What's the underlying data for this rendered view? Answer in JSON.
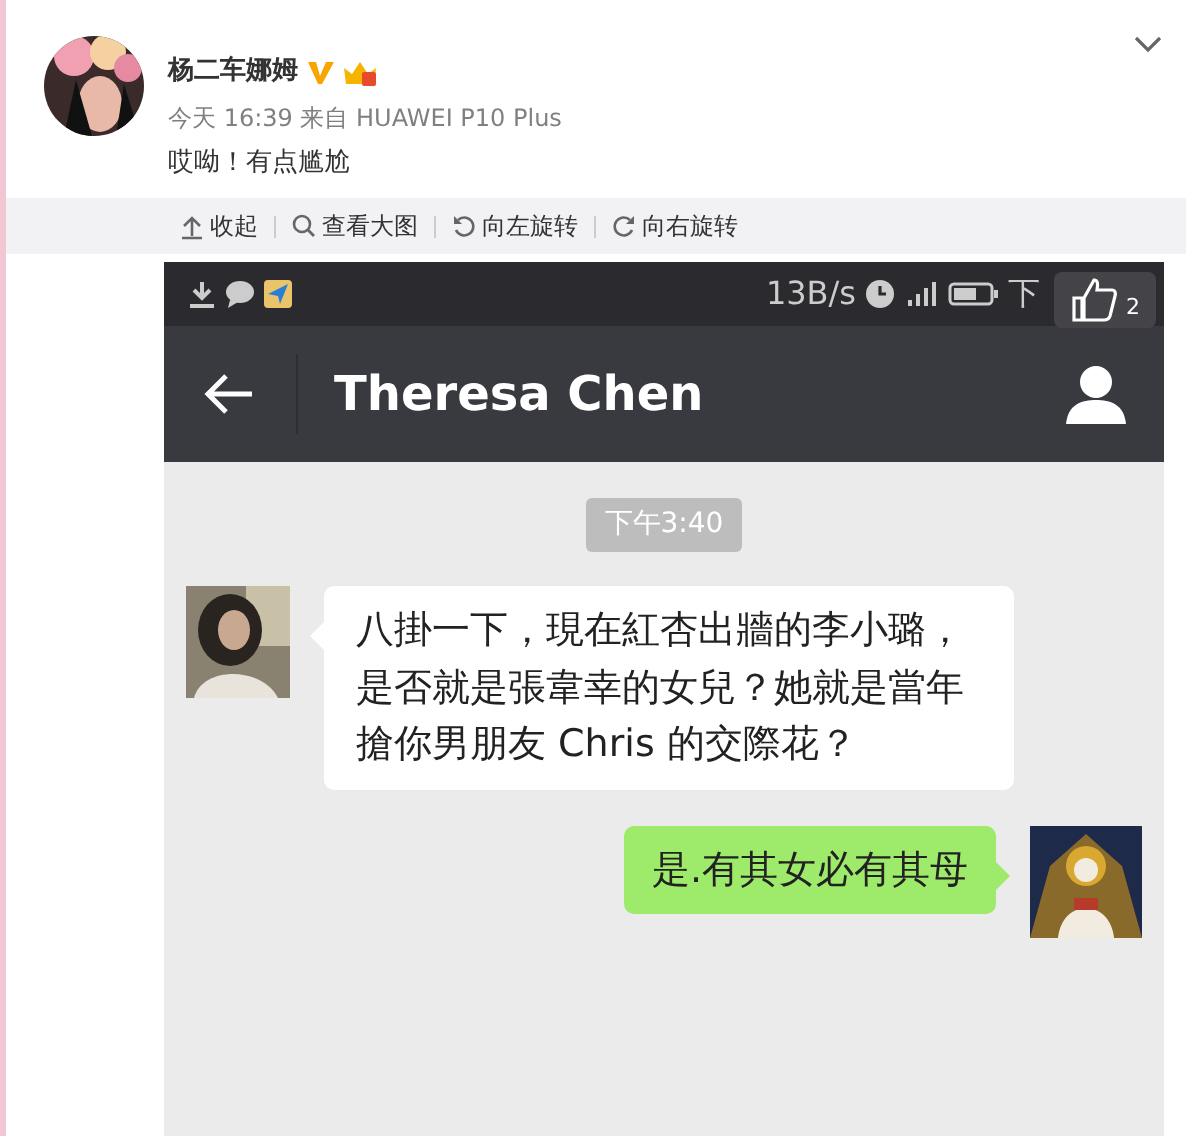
{
  "post": {
    "author": "杨二车娜姆",
    "verified": true,
    "meta": "今天 16:39 来自 HUAWEI P10 Plus",
    "text": "哎呦！有点尴尬",
    "toolbar": [
      {
        "kind": "collapse",
        "label": "收起"
      },
      {
        "kind": "zoom",
        "label": "查看大图"
      },
      {
        "kind": "rotate_left",
        "label": "向左旋转"
      },
      {
        "kind": "rotate_right",
        "label": "向右旋转"
      }
    ]
  },
  "screenshot": {
    "status_bar": {
      "speed": "13B/s",
      "time": "下"
    },
    "like": {
      "count": "2"
    },
    "chat_title": "Theresa Chen",
    "timestamp": "下午3:40",
    "messages": [
      {
        "kind": "received",
        "text": "八掛一下，現在紅杏出牆的李小璐，是否就是張韋幸的女兒？她就是當年搶你男朋友 Chris 的交際花？"
      },
      {
        "kind": "sent",
        "text": "是.有其女必有其母"
      }
    ]
  }
}
